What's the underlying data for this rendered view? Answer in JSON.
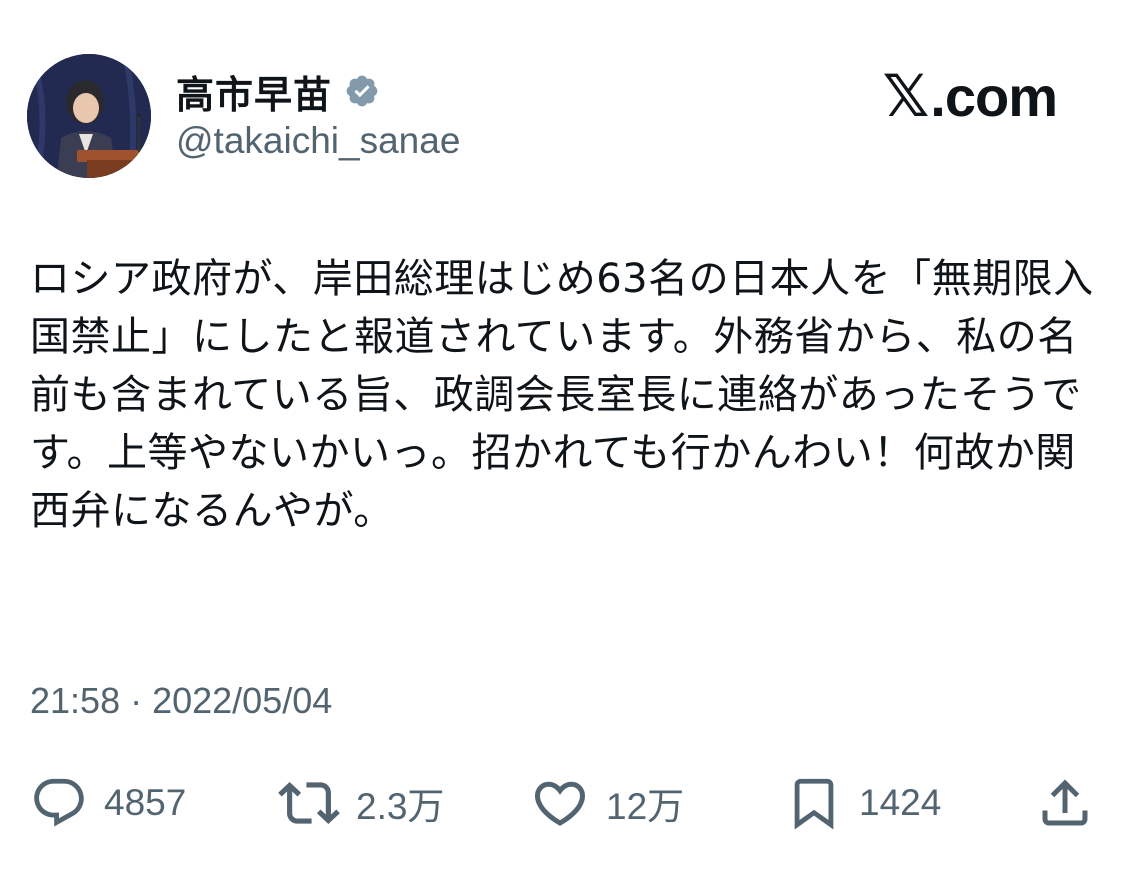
{
  "brand": {
    "logo_text": ".com",
    "logo_mark": "𝕏"
  },
  "user": {
    "display_name": "高市早苗",
    "handle": "@takaichi_sanae",
    "verified_icon": "verified-badge-icon",
    "avatar": "profile-photo"
  },
  "tweet": {
    "text": "ロシア政府が、岸田総理はじめ63名の日本人を「無期限入国禁止」にしたと報道されています。外務省から、私の名前も含まれている旨、政調会長室長に連絡があったそうです。上等やないかいっ。招かれても行かんわい！何故か関西弁になるんやが。",
    "timestamp": "21:58 · 2022/05/04"
  },
  "actions": {
    "reply": {
      "icon": "reply-icon",
      "count": "4857"
    },
    "repost": {
      "icon": "repost-icon",
      "count": "2.3万"
    },
    "like": {
      "icon": "heart-icon",
      "count": "12万"
    },
    "bookmark": {
      "icon": "bookmark-icon",
      "count": "1424"
    },
    "share": {
      "icon": "share-icon"
    }
  },
  "colors": {
    "text_primary": "#0f1419",
    "text_secondary": "#536471",
    "verified_badge": "#829aab",
    "background": "#ffffff"
  }
}
